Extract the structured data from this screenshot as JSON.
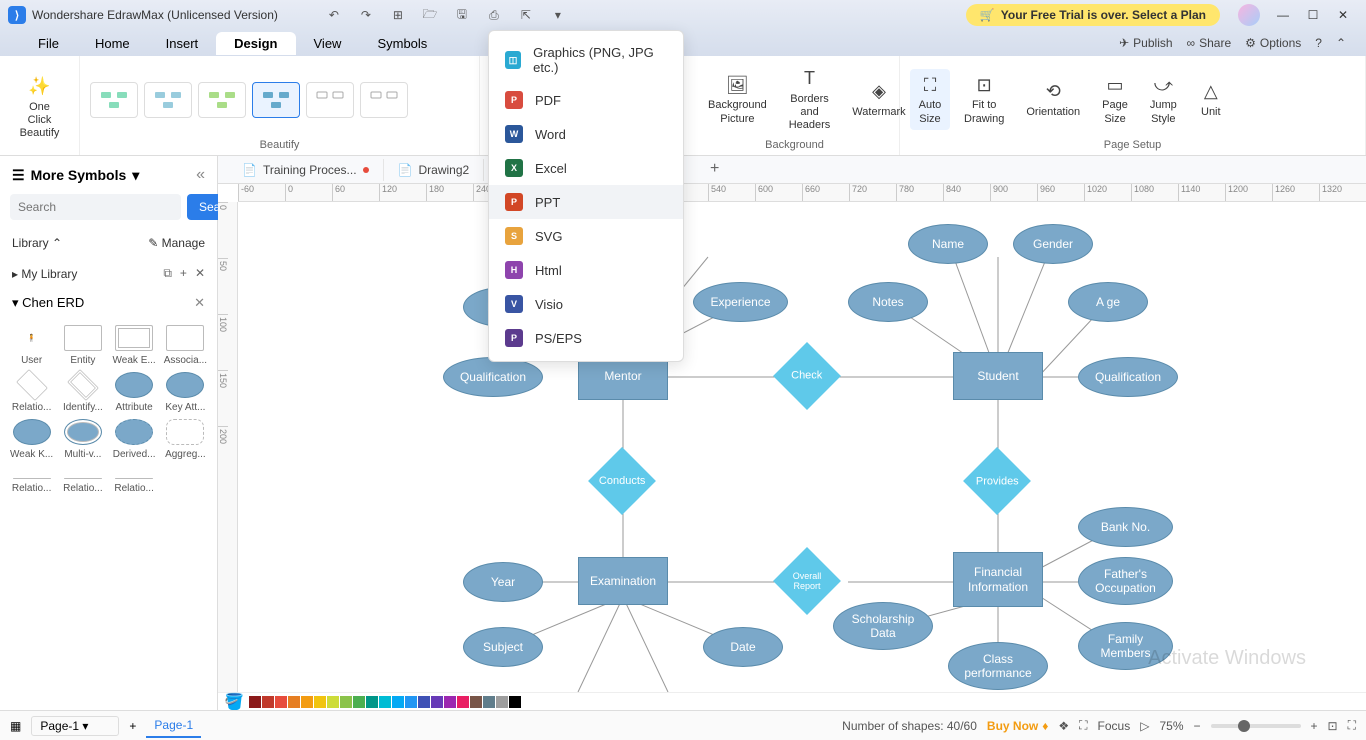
{
  "app": {
    "title": "Wondershare EdrawMax (Unlicensed Version)"
  },
  "trial": {
    "text": "Your Free Trial is over. Select a Plan"
  },
  "menus": {
    "file": "File",
    "home": "Home",
    "insert": "Insert",
    "design": "Design",
    "view": "View",
    "symbols": "Symbols",
    "publish": "Publish",
    "share": "Share",
    "options": "Options"
  },
  "ribbon": {
    "one_click": "One Click\nBeautify",
    "beautify_label": "Beautify",
    "bg_picture": "Background\nPicture",
    "borders": "Borders and\nHeaders",
    "watermark": "Watermark",
    "background_label": "Background",
    "auto_size": "Auto\nSize",
    "fit": "Fit to\nDrawing",
    "orientation": "Orientation",
    "page_size": "Page\nSize",
    "jump_style": "Jump\nStyle",
    "unit": "Unit",
    "page_setup_label": "Page Setup"
  },
  "tabs": {
    "t1": "Training Proces...",
    "t2": "Drawing2"
  },
  "left": {
    "more_symbols": "More Symbols",
    "search_btn": "Search",
    "search_placeholder": "Search",
    "library": "Library",
    "manage": "Manage",
    "my_library": "My Library",
    "chen_erd": "Chen ERD",
    "shapes": {
      "user": "User",
      "entity": "Entity",
      "weak_e": "Weak E...",
      "assoc": "Associa...",
      "relatio": "Relatio...",
      "identify": "Identify...",
      "attribute": "Attribute",
      "key_att": "Key Att...",
      "weak_k": "Weak K...",
      "multi_v": "Multi-v...",
      "derived": "Derived...",
      "aggreg": "Aggreg...",
      "rel1": "Relatio...",
      "rel2": "Relatio...",
      "rel3": "Relatio..."
    }
  },
  "export": {
    "graphics": "Graphics (PNG, JPG etc.)",
    "pdf": "PDF",
    "word": "Word",
    "excel": "Excel",
    "ppt": "PPT",
    "svg": "SVG",
    "html": "Html",
    "visio": "Visio",
    "ps": "PS/EPS"
  },
  "erd": {
    "name1": "Name",
    "name2": "Name",
    "gender": "Gender",
    "experience": "Experience",
    "notes": "Notes",
    "age": "A ge",
    "qualification1": "Qualification",
    "qualification2": "Qualification",
    "mentor": "Mentor",
    "student": "Student",
    "check": "Check",
    "conducts": "Conducts",
    "provides": "Provides",
    "year": "Year",
    "examination": "Examination",
    "financial_info": "Financial\nInformation",
    "overall_report": "Overall Report",
    "subject": "Subject",
    "date": "Date",
    "scholarship": "Scholarship\nData",
    "bank_no": "Bank No.",
    "father_occ": "Father's\nOccupation",
    "family": "Family\nMembers",
    "class_perf": "Class\nperformance"
  },
  "status": {
    "page1": "Page-1",
    "shapes": "Number of shapes: 40/60",
    "buy": "Buy Now",
    "focus": "Focus",
    "zoom": "75%"
  },
  "watermark": {
    "line1": "Activate Windows"
  }
}
